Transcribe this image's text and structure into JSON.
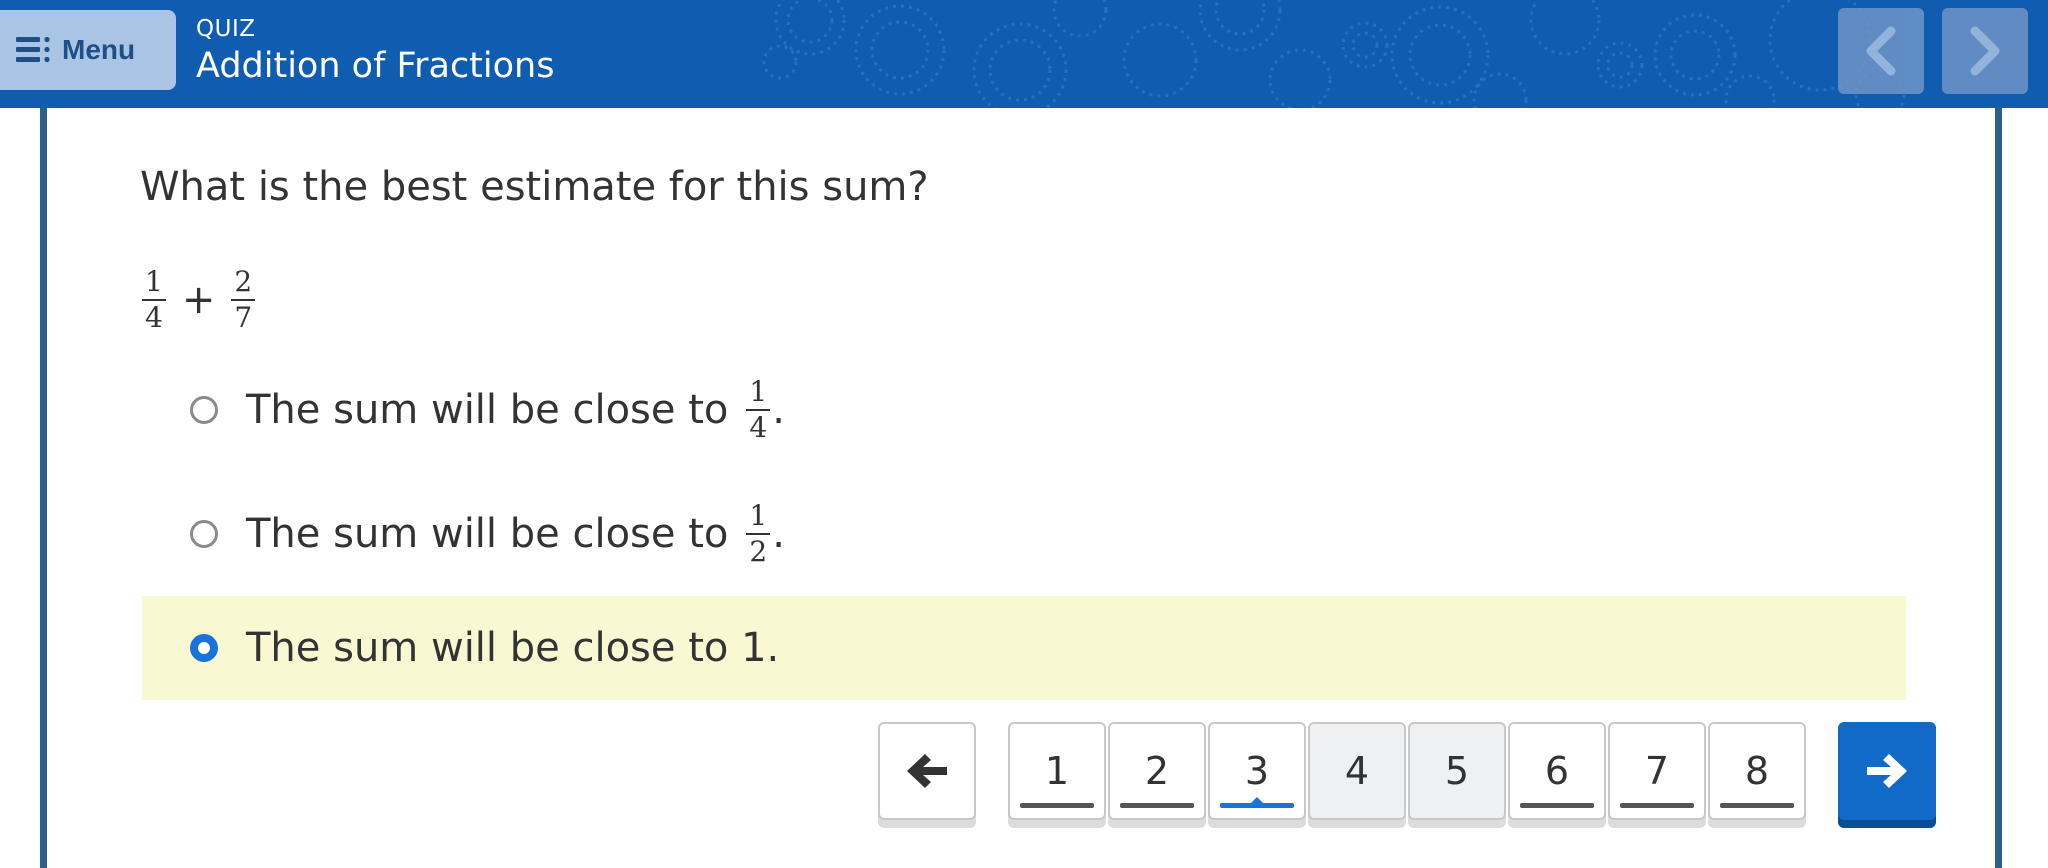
{
  "header": {
    "menu_label": "Menu",
    "section_label": "QUIZ",
    "title": "Addition of Fractions",
    "prev_icon": "chevron-left-icon",
    "next_icon": "chevron-right-icon",
    "menu_icon": "menu-list-icon"
  },
  "question": {
    "text": "What is the best estimate for this sum?",
    "expression": {
      "a": {
        "num": "1",
        "den": "4"
      },
      "op": "+",
      "b": {
        "num": "2",
        "den": "7"
      }
    }
  },
  "options": [
    {
      "prefix": "The sum will be close to",
      "frac": {
        "num": "1",
        "den": "4"
      },
      "suffix": ".",
      "selected": false
    },
    {
      "prefix": "The sum will be close to",
      "frac": {
        "num": "1",
        "den": "2"
      },
      "suffix": ".",
      "selected": false
    },
    {
      "text": "The sum will be close to 1.",
      "selected": true
    }
  ],
  "pager": {
    "back_icon": "arrow-left-icon",
    "forward_icon": "arrow-right-icon",
    "pages": [
      {
        "label": "1",
        "answered": true,
        "current": false
      },
      {
        "label": "2",
        "answered": true,
        "current": false
      },
      {
        "label": "3",
        "answered": true,
        "current": true
      },
      {
        "label": "4",
        "answered": false,
        "current": false
      },
      {
        "label": "5",
        "answered": false,
        "current": false
      },
      {
        "label": "6",
        "answered": true,
        "current": false
      },
      {
        "label": "7",
        "answered": true,
        "current": false
      },
      {
        "label": "8",
        "answered": true,
        "current": false
      }
    ]
  },
  "colors": {
    "header_bg": "#105cb0",
    "frame_border": "#2e5f8a",
    "selected_bg": "#f8f9d3",
    "accent": "#1a73d9",
    "forward_bg": "#1169c8"
  }
}
